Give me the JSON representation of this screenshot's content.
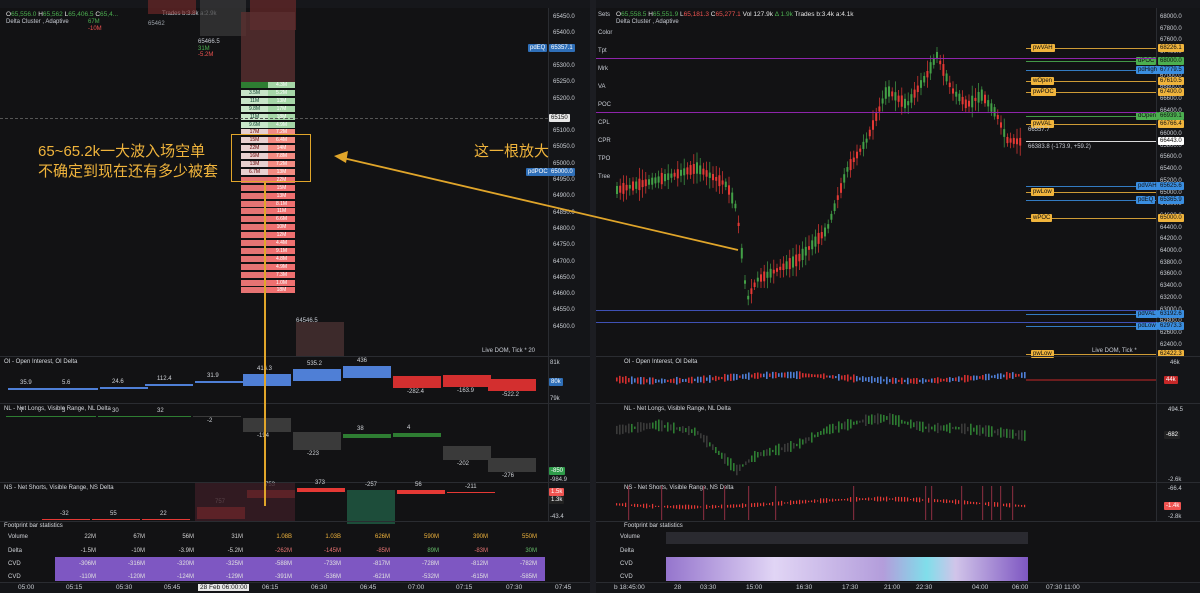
{
  "left": {
    "ohlc": {
      "o": "65,556.0",
      "h": "65,562",
      "l": "65,406.5",
      "c": "65,4..."
    },
    "trades": "Trades b:3.8k a:2.9k",
    "study_title": "Delta Cluster , Adaptive",
    "live_dom": "Live DOM, Tick * 20",
    "price_labels": [
      "65450.0",
      "65400.0",
      "65350.0",
      "65300.0",
      "65250.0",
      "65200.0",
      "65150",
      "65100.0",
      "65050.0",
      "65000.0",
      "64950.0",
      "64900.0",
      "64850.0",
      "64800.0",
      "64750.0",
      "64700.0",
      "64650.0",
      "64600.0",
      "64550.0",
      "64500.0"
    ],
    "tags": {
      "pdEQ": "pdEQ",
      "pdEQ_val": "65357.1",
      "pdPOC": "pdPOC",
      "pdPOC_val": "65000.0",
      "cur": "65150"
    },
    "prelabels": {
      "a": "65462",
      "b": "65466.5",
      "c": "64546.5",
      "d": "31M",
      "e": "-5.2M",
      "f": "67M",
      "g": "-10M",
      "h": "56M",
      "i": "-3.9M"
    },
    "annotation_main": [
      "65~65.2k一大波入场空单",
      "不确定到现在还有多少被套"
    ],
    "annotation_side": "这一根放大",
    "oi": {
      "title": "OI - Open Interest, OI Delta",
      "labels": [
        "35.9",
        "5.6",
        "24.6",
        "112.4",
        "31.9",
        "416.3",
        "535.2",
        "436",
        "-282.4",
        "-163.9",
        "-522.2"
      ],
      "axis": [
        "81k",
        "80k",
        "79k"
      ]
    },
    "nl": {
      "title": "NL - Net Longs, Visible Range, NL Delta",
      "labels": [
        "7",
        "3",
        "30",
        "32",
        "-2",
        "-194",
        "-223",
        "38",
        "4",
        "-202",
        "-276"
      ],
      "axis": [
        "-850",
        "-984.9"
      ]
    },
    "ns": {
      "title": "NS - Net Shorts, Visible Range, NS Delta",
      "labels": [
        "-32",
        "55",
        "22",
        "757",
        "753",
        "373",
        "-257",
        "56",
        "-211"
      ],
      "axis": [
        "1.5k",
        "1.3k",
        "-43.4"
      ]
    },
    "stats": {
      "title": "Footprint bar statistics",
      "rows": [
        "Volume",
        "Delta",
        "CVD",
        "CVD"
      ],
      "volume": [
        "22M",
        "67M",
        "56M",
        "31M",
        "1.08B",
        "1.03B",
        "626M",
        "590M",
        "390M",
        "550M"
      ],
      "delta": [
        "-1.5M",
        "-10M",
        "-3.9M",
        "-5.2M",
        "-262M",
        "-145M",
        "-85M",
        "89M",
        "-83M",
        "30M"
      ],
      "cvd1": [
        "-306M",
        "-316M",
        "-320M",
        "-325M",
        "-588M",
        "-733M",
        "-817M",
        "-728M",
        "-812M",
        "-782M"
      ],
      "cvd2": [
        "-110M",
        "-120M",
        "-124M",
        "-129M",
        "-391M",
        "-536M",
        "-621M",
        "-532M",
        "-615M",
        "-585M"
      ]
    },
    "time": [
      "05:00",
      "05:15",
      "05:30",
      "05:45",
      "28 Feb 06:00:00",
      "06:15",
      "06:30",
      "06:45",
      "07:00",
      "07:15",
      "07:30",
      "07:45"
    ],
    "footprint": [
      [
        "",
        "4.3M"
      ],
      [
        "3.5M",
        "5.2M"
      ],
      [
        "11M",
        "13M"
      ],
      [
        "9.8M",
        "17M"
      ],
      [
        "11M",
        "18M"
      ],
      [
        "9.6M",
        "4.9M"
      ],
      [
        "17M",
        "7.2M"
      ],
      [
        "15M",
        "6.4M"
      ],
      [
        "22M",
        "14M"
      ],
      [
        "16M",
        "7.8M"
      ],
      [
        "13M",
        "7.2M"
      ],
      [
        "6.7M",
        "13M"
      ],
      [
        "",
        "22M"
      ],
      [
        "",
        "15M"
      ],
      [
        "",
        "13M"
      ],
      [
        "",
        "8.1M"
      ],
      [
        "",
        "11M"
      ],
      [
        "",
        "6.6M"
      ],
      [
        "",
        "10M"
      ],
      [
        "",
        "12M"
      ],
      [
        "",
        "4.4M"
      ],
      [
        "",
        "9.1M"
      ],
      [
        "",
        "4.8M"
      ],
      [
        "",
        "4.9M"
      ],
      [
        "",
        "7.3M"
      ],
      [
        "",
        "1.0M"
      ],
      [
        "",
        "18M"
      ]
    ]
  },
  "right": {
    "ohlc": {
      "o": "65,558.5",
      "h": "65,551.9",
      "l": "65,181.3",
      "c": "65,277.1"
    },
    "vol": "Vol 127.9k",
    "delta": "Δ 1.9k",
    "trades": "Trades b:3.4k a:4.1k",
    "study_title": "Delta Cluster , Adaptive",
    "live_dom": "Live DOM, Tick *",
    "side_buttons": [
      "Sets",
      "Color",
      "Tpt",
      "Mrk",
      "VA",
      "POC",
      "CPL",
      "CPR",
      "TPO",
      "Tree"
    ],
    "price_labels": [
      "68000.0",
      "67800.0",
      "67600.0",
      "67400.0",
      "67200.0",
      "67000.0",
      "66800.0",
      "66600.0",
      "66400.0",
      "66200.0",
      "66000.0",
      "65800.0",
      "65600.0",
      "65400.0",
      "65200.0",
      "65000.0",
      "64800.0",
      "64600.0",
      "64400.0",
      "64200.0",
      "64000.0",
      "63800.0",
      "63600.0",
      "63400.0",
      "63200.0",
      "63000.0",
      "62800.0",
      "62600.0",
      "62400.0"
    ],
    "levels": [
      {
        "name": "pwVAH",
        "val": "68226.1",
        "color": "#f0b43c"
      },
      {
        "name": "dPOC",
        "val": "68000.0",
        "color": "#4caf50"
      },
      {
        "name": "pdHigh",
        "val": "67779.5",
        "color": "#3a8ee0"
      },
      {
        "name": "wOpen",
        "val": "67610.5",
        "color": "#f0b43c"
      },
      {
        "name": "pwPOC",
        "val": "67400.0",
        "color": "#f0b43c"
      },
      {
        "name": "dOpen",
        "val": "66939.1",
        "color": "#4caf50"
      },
      {
        "name": "pwVAL",
        "val": "66766.4",
        "color": "#f0b43c"
      },
      {
        "name": "cur",
        "val": "66443.0",
        "color": "#ffffff"
      },
      {
        "name": "pdVAH",
        "val": "65625.6",
        "color": "#3a8ee0"
      },
      {
        "name": "pdEQ",
        "val": "65365.9",
        "color": "#3a8ee0"
      },
      {
        "name": "wPOC",
        "val": "65000.0",
        "color": "#f0b43c"
      },
      {
        "name": "pwLow",
        "val": "",
        "color": "#f0b43c"
      },
      {
        "name": "pdVAL",
        "val": "63192.6",
        "color": "#3a8ee0"
      },
      {
        "name": "pdLow",
        "val": "62973.3",
        "color": "#3a8ee0"
      },
      {
        "name": "pwLow",
        "val": "62422.3",
        "color": "#f0b43c"
      }
    ],
    "price_notes": [
      "66557.7",
      "66383.8 (-173.9, +59.2)"
    ],
    "oi": {
      "title": "OI - Open Interest, OI Delta",
      "axis": [
        "46k",
        "44k"
      ]
    },
    "nl": {
      "title": "NL - Net Longs, Visible Range, NL Delta",
      "axis": [
        "494.5",
        "-682",
        "-2.6k"
      ]
    },
    "ns": {
      "title": "NS - Net Shorts, Visible Range, NS Delta",
      "axis": [
        "-66.4",
        "-1.4k",
        "-2.8k"
      ]
    },
    "stats": {
      "title": "Footprint bar statistics",
      "rows": [
        "Volume",
        "Delta",
        "CVD",
        "CVD"
      ]
    },
    "time": [
      "b 18:45:00",
      "28",
      "03:30",
      "15:00",
      "16:30",
      "17:30",
      "21:00",
      "22:30",
      "04:00",
      "06:00",
      "07:30",
      "11:00"
    ]
  }
}
